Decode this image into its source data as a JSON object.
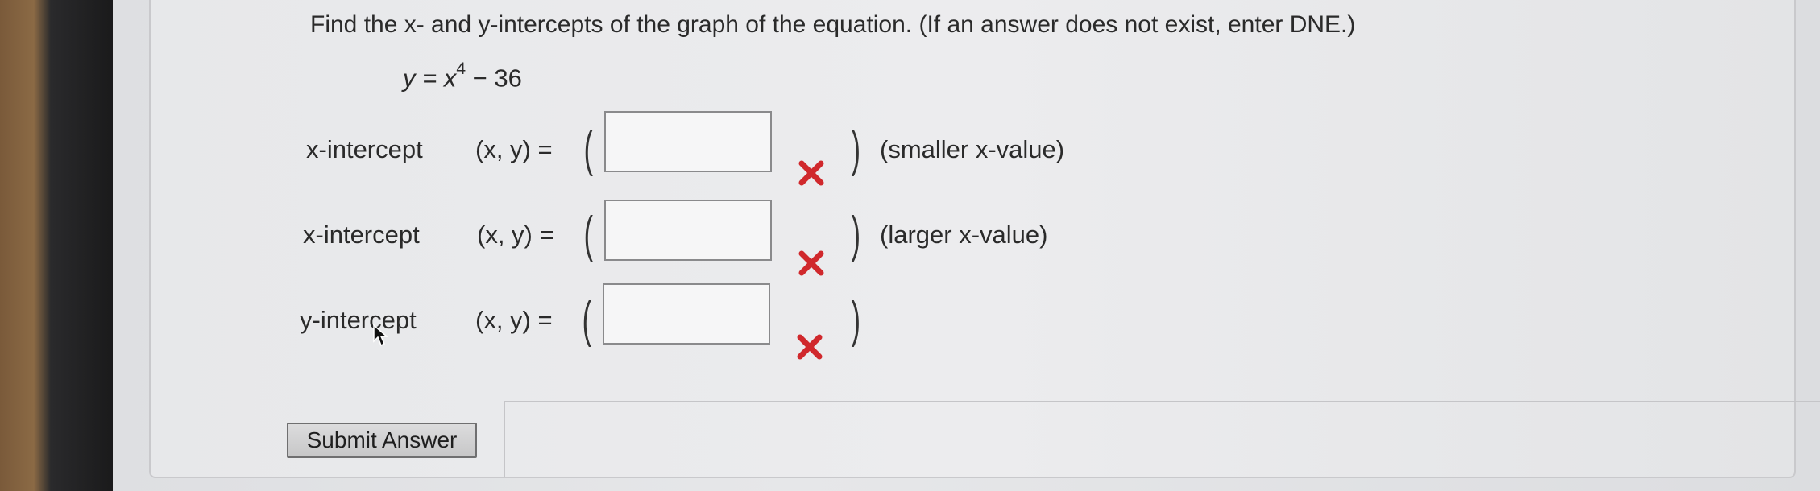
{
  "question": {
    "text": "Find the x- and y-intercepts of the graph of the equation. (If an answer does not exist, enter DNE.)"
  },
  "equation": {
    "lhs": "y = x",
    "exponent": "4",
    "rhs": " − 36"
  },
  "rows": [
    {
      "label": "x-intercept",
      "coords": "(x, y) =",
      "value": "",
      "note": "(smaller x-value)",
      "status": "incorrect"
    },
    {
      "label": "x-intercept",
      "coords": "(x, y) =",
      "value": "",
      "note": "(larger x-value)",
      "status": "incorrect"
    },
    {
      "label": "y-intercept",
      "coords": "(x, y) =",
      "value": "",
      "note": "",
      "status": "incorrect"
    }
  ],
  "submit": {
    "label": "Submit Answer"
  },
  "icons": {
    "incorrect": "x-mark-icon",
    "cursor": "mouse-pointer-icon"
  },
  "colors": {
    "incorrect": "#d0282c"
  }
}
